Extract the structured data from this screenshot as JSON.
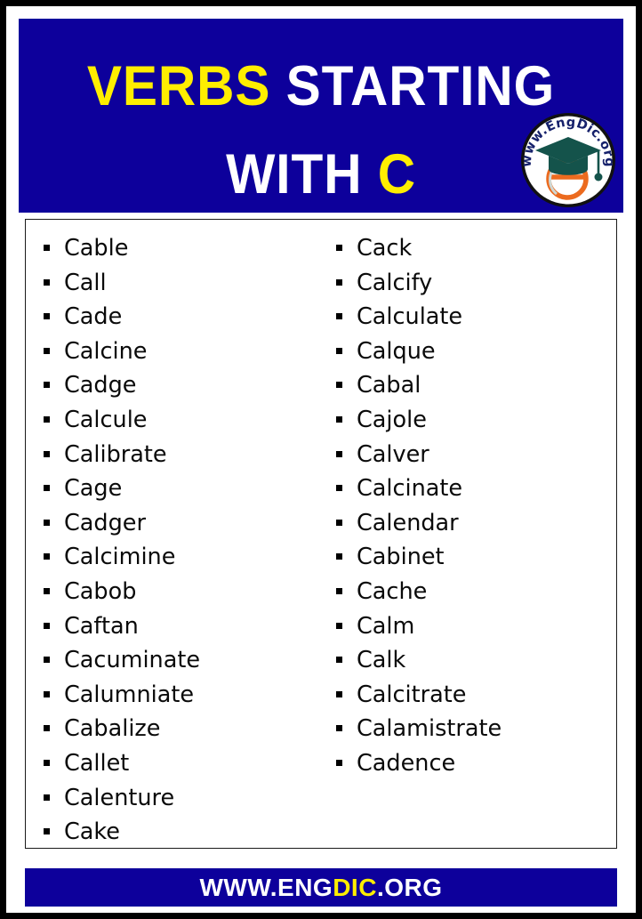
{
  "header": {
    "title_line_1": {
      "highlight": "VERBS",
      "rest": "STARTING"
    },
    "title_line_2": {
      "rest": "WITH",
      "highlight": "C"
    },
    "background_color": "#0d009b",
    "highlight_color": "#ffee00",
    "text_color": "#ffffff"
  },
  "logo": {
    "name": "engdic-logo",
    "ring_text": "www.EngDic.org",
    "letter": "e",
    "ring_text_color": "#16216b",
    "cap_color": "#14534b",
    "letter_color": "#ec6b1f",
    "circle_color": "#ffffff",
    "outline_color": "#111111"
  },
  "word_list": {
    "bullet_glyph": "square-bullet",
    "left_column": [
      "Cable",
      "Call",
      "Cade",
      "Calcine",
      "Cadge",
      "Calcule",
      "Calibrate",
      "Cage",
      "Cadger",
      "Calcimine",
      "Cabob",
      "Caftan",
      "Cacuminate",
      "Calumniate",
      "Cabalize",
      "Callet",
      "Calenture",
      "Cake"
    ],
    "right_column": [
      "Cack",
      "Calcify",
      "Calculate",
      "Calque",
      "Cabal",
      "Cajole",
      "Calver",
      "Calcinate",
      "Calendar",
      "Cabinet",
      "Cache",
      "Calm",
      "Calk",
      "Calcitrate",
      "Calamistrate",
      "Cadence"
    ]
  },
  "footer": {
    "prefix": "WWW.ENG",
    "highlight": "DIC",
    "suffix": ".ORG",
    "background_color": "#0d009b",
    "highlight_color": "#ffee00",
    "text_color": "#ffffff"
  }
}
